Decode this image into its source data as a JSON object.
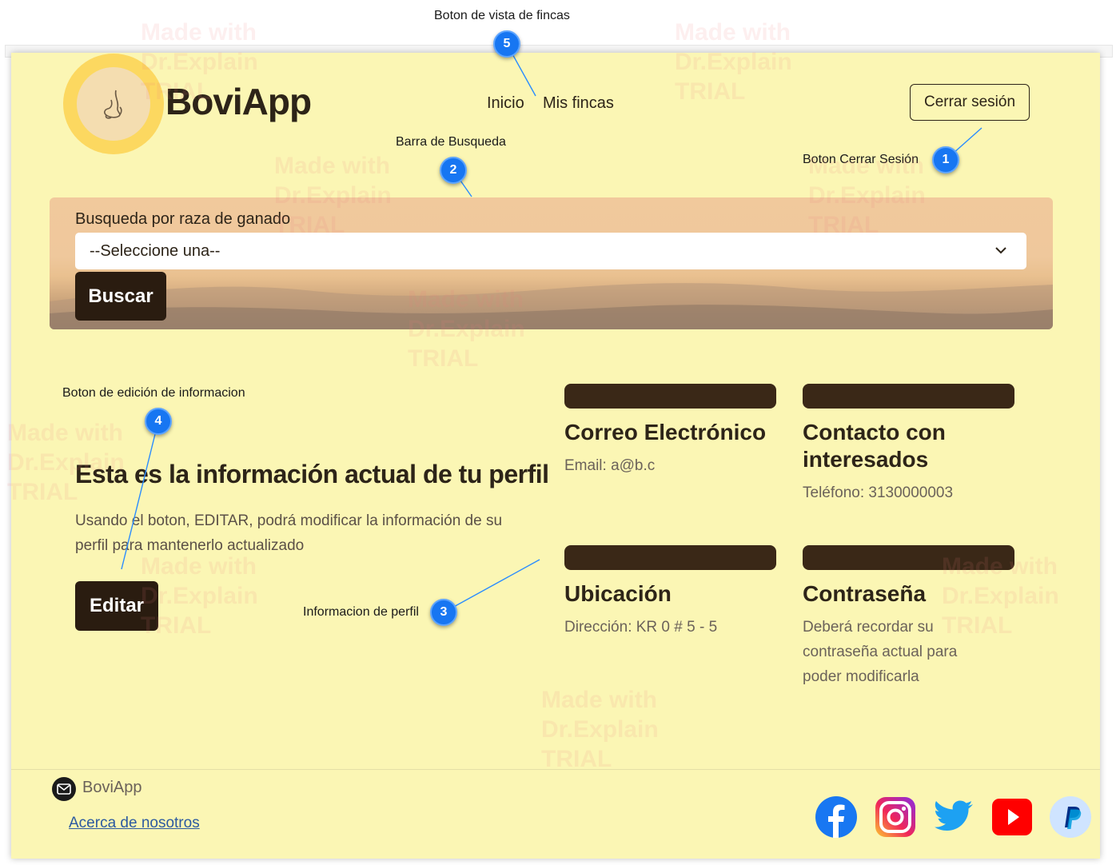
{
  "header": {
    "brand": "BoviApp",
    "nav": [
      "Inicio",
      "Mis fincas"
    ],
    "logout_label": "Cerrar sesión"
  },
  "search": {
    "label": "Busqueda por raza de ganado",
    "select_value": "--Seleccione una--",
    "button_label": "Buscar"
  },
  "profile": {
    "heading": "Esta es la información actual de tu perfil",
    "description": "Usando el boton, EDITAR, podrá modificar la información de su perfil para mantenerlo actualizado",
    "edit_label": "Editar"
  },
  "cards": [
    {
      "title": "Correo Electrónico",
      "text": "Email: a@b.c"
    },
    {
      "title": "Contacto con interesados",
      "text": "Teléfono: 3130000003"
    },
    {
      "title": "Ubicación",
      "text": "Dirección: KR 0 # 5 - 5"
    },
    {
      "title": "Contraseña",
      "text": "Deberá recordar su contraseña actual para poder modificarla"
    }
  ],
  "footer": {
    "brand": "BoviApp",
    "link": "Acerca de nosotros",
    "social_icons": [
      "facebook-icon",
      "instagram-icon",
      "twitter-icon",
      "youtube-icon",
      "paypal-icon"
    ]
  },
  "callouts": [
    {
      "number": "1",
      "label": "Boton Cerrar Sesión"
    },
    {
      "number": "2",
      "label": "Barra de Busqueda"
    },
    {
      "number": "3",
      "label": "Informacion de perfil"
    },
    {
      "number": "4",
      "label": "Boton de edición de informacion"
    },
    {
      "number": "5",
      "label": "Boton de vista de fincas"
    }
  ],
  "watermark": [
    "Made with",
    "Dr.Explain",
    "TRIAL"
  ],
  "colors": {
    "page_bg": "#fbf6b4",
    "dark": "#2a1c10",
    "callout": "#1776f2",
    "link": "#2c5aa0"
  }
}
